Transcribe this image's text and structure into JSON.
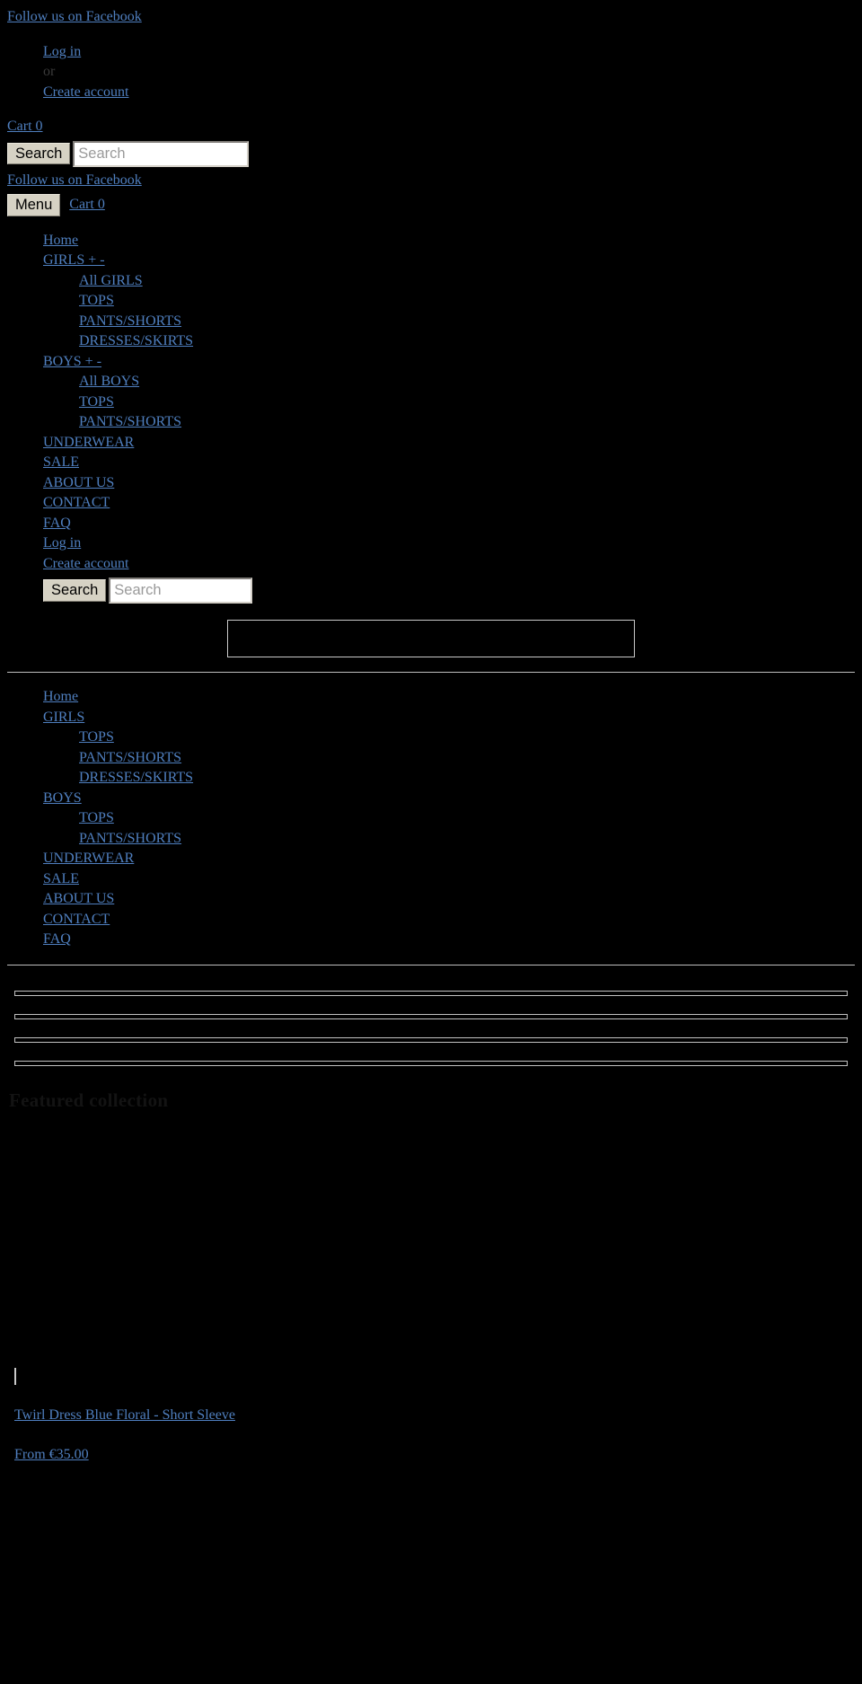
{
  "announcement": {
    "facebook_link": "Follow us on Facebook"
  },
  "account": {
    "login_label": "Log in",
    "or_text": "or",
    "create_account_label": "Create account"
  },
  "cart": {
    "label": "Cart 0"
  },
  "search": {
    "button_label": "Search",
    "placeholder": "Search",
    "value": ""
  },
  "mobile_bar": {
    "facebook_link": "Follow us on Facebook",
    "menu_label": "Menu",
    "cart_label": "Cart 0"
  },
  "mobile_nav": {
    "items": [
      {
        "label": "Home",
        "children": []
      },
      {
        "label": "GIRLS + -",
        "children": [
          "All GIRLS",
          "TOPS",
          "PANTS/SHORTS",
          "DRESSES/SKIRTS"
        ]
      },
      {
        "label": "BOYS + -",
        "children": [
          "All BOYS",
          "TOPS",
          "PANTS/SHORTS"
        ]
      },
      {
        "label": "UNDERWEAR",
        "children": []
      },
      {
        "label": "SALE",
        "children": []
      },
      {
        "label": "ABOUT US",
        "children": []
      },
      {
        "label": "CONTACT",
        "children": []
      },
      {
        "label": "FAQ",
        "children": []
      },
      {
        "label": "Log in",
        "children": []
      },
      {
        "label": "Create account",
        "children": []
      }
    ],
    "search_button_label": "Search",
    "search_placeholder": "Search"
  },
  "logo": {
    "alt": ""
  },
  "main_nav": {
    "items": [
      {
        "label": "Home",
        "children": []
      },
      {
        "label": "GIRLS",
        "children": [
          "TOPS",
          "PANTS/SHORTS",
          "DRESSES/SKIRTS"
        ]
      },
      {
        "label": "BOYS",
        "children": [
          "TOPS",
          "PANTS/SHORTS"
        ]
      },
      {
        "label": "UNDERWEAR",
        "children": []
      },
      {
        "label": "SALE",
        "children": []
      },
      {
        "label": "ABOUT US",
        "children": []
      },
      {
        "label": "CONTACT",
        "children": []
      },
      {
        "label": "FAQ",
        "children": []
      }
    ]
  },
  "slideshow": {
    "slide_count": 4
  },
  "featured": {
    "heading": "Featured collection",
    "products": [
      {
        "title": "Twirl Dress Blue Floral - Short Sleeve",
        "price": "From €35.00"
      }
    ]
  },
  "colors": {
    "background": "#000000",
    "link": "#4f7fbf",
    "button_face": "#d6d2c4",
    "input_background": "#ffffff",
    "rule": "#bfbfbf",
    "dim_heading": "#131313"
  }
}
